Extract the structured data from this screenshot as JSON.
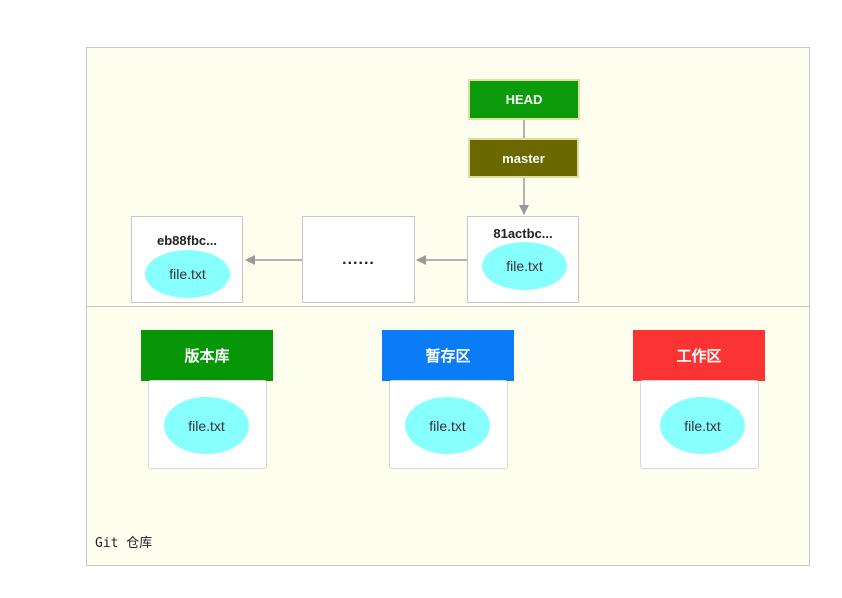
{
  "refs": {
    "head": "HEAD",
    "branch": "master"
  },
  "commits": [
    {
      "hash": "eb88fbc...",
      "file": "file.txt"
    },
    {
      "label": "......"
    },
    {
      "hash": "81actbc...",
      "file": "file.txt"
    }
  ],
  "areas": [
    {
      "title": "版本库",
      "file": "file.txt",
      "color": "#079607"
    },
    {
      "title": "暂存区",
      "file": "file.txt",
      "color": "#0a7cf6"
    },
    {
      "title": "工作区",
      "file": "file.txt",
      "color": "#fc3333"
    }
  ],
  "repo_label": "Git 仓库"
}
